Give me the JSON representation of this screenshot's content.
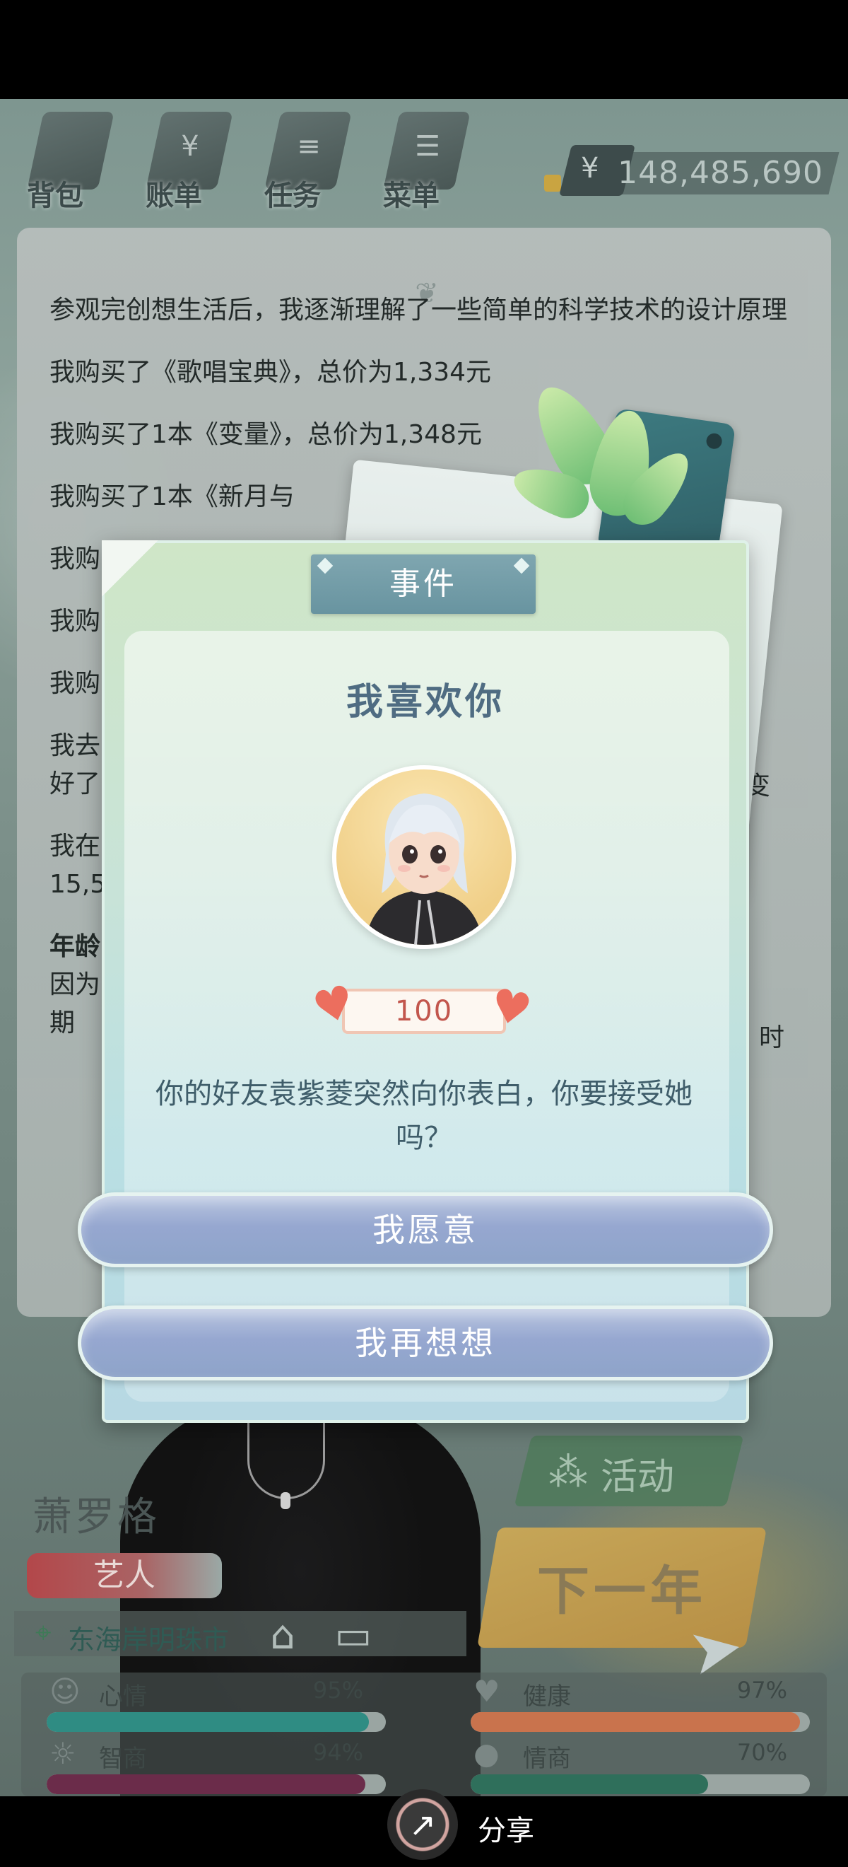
{
  "toolbar": {
    "items": [
      {
        "label": "背包",
        "icon": "backpack-icon"
      },
      {
        "label": "账单",
        "icon": "bill-icon"
      },
      {
        "label": "任务",
        "icon": "task-icon"
      },
      {
        "label": "菜单",
        "icon": "menu-icon"
      }
    ],
    "currency_symbol": "¥",
    "money": "148,485,690"
  },
  "log": {
    "lines": [
      "参观完创想生活后，我逐渐理解了一些简单的科学技术的设计原理",
      "我购买了《歌唱宝典》，总价为1,334元",
      "我购买了1本《变量》，总价为1,348元",
      "我购买了1本《新月与",
      "我购",
      "我购",
      "我购",
      "我去",
      "好了",
      "我在",
      "15,5",
      "年龄",
      "因为",
      "期"
    ],
    "right_fragments": [
      "变",
      "时"
    ]
  },
  "character": {
    "name": "萧罗格",
    "job": "艺人",
    "location": "东海岸明珠市"
  },
  "actions": {
    "activity": "活动",
    "next_year": "下一年"
  },
  "stats": [
    {
      "label": "心情",
      "value": "95%",
      "level": 0.95,
      "color": "#2f8c83",
      "icon": "smile-icon"
    },
    {
      "label": "健康",
      "value": "97%",
      "level": 0.97,
      "color": "#c9734d",
      "icon": "heart-icon"
    },
    {
      "label": "智商",
      "value": "94%",
      "level": 0.94,
      "color": "#6b2c4a",
      "icon": "bulb-icon"
    },
    {
      "label": "情商",
      "value": "70%",
      "level": 0.7,
      "color": "#2f6f5b",
      "icon": "apple-icon"
    }
  ],
  "share": {
    "label": "分享"
  },
  "modal": {
    "tab": "事件",
    "title": "我喜欢你",
    "affinity": "100",
    "description": "你的好友袁紫菱突然向你表白，你要接受她吗？",
    "accept": "我愿意",
    "decline": "我再想想"
  }
}
